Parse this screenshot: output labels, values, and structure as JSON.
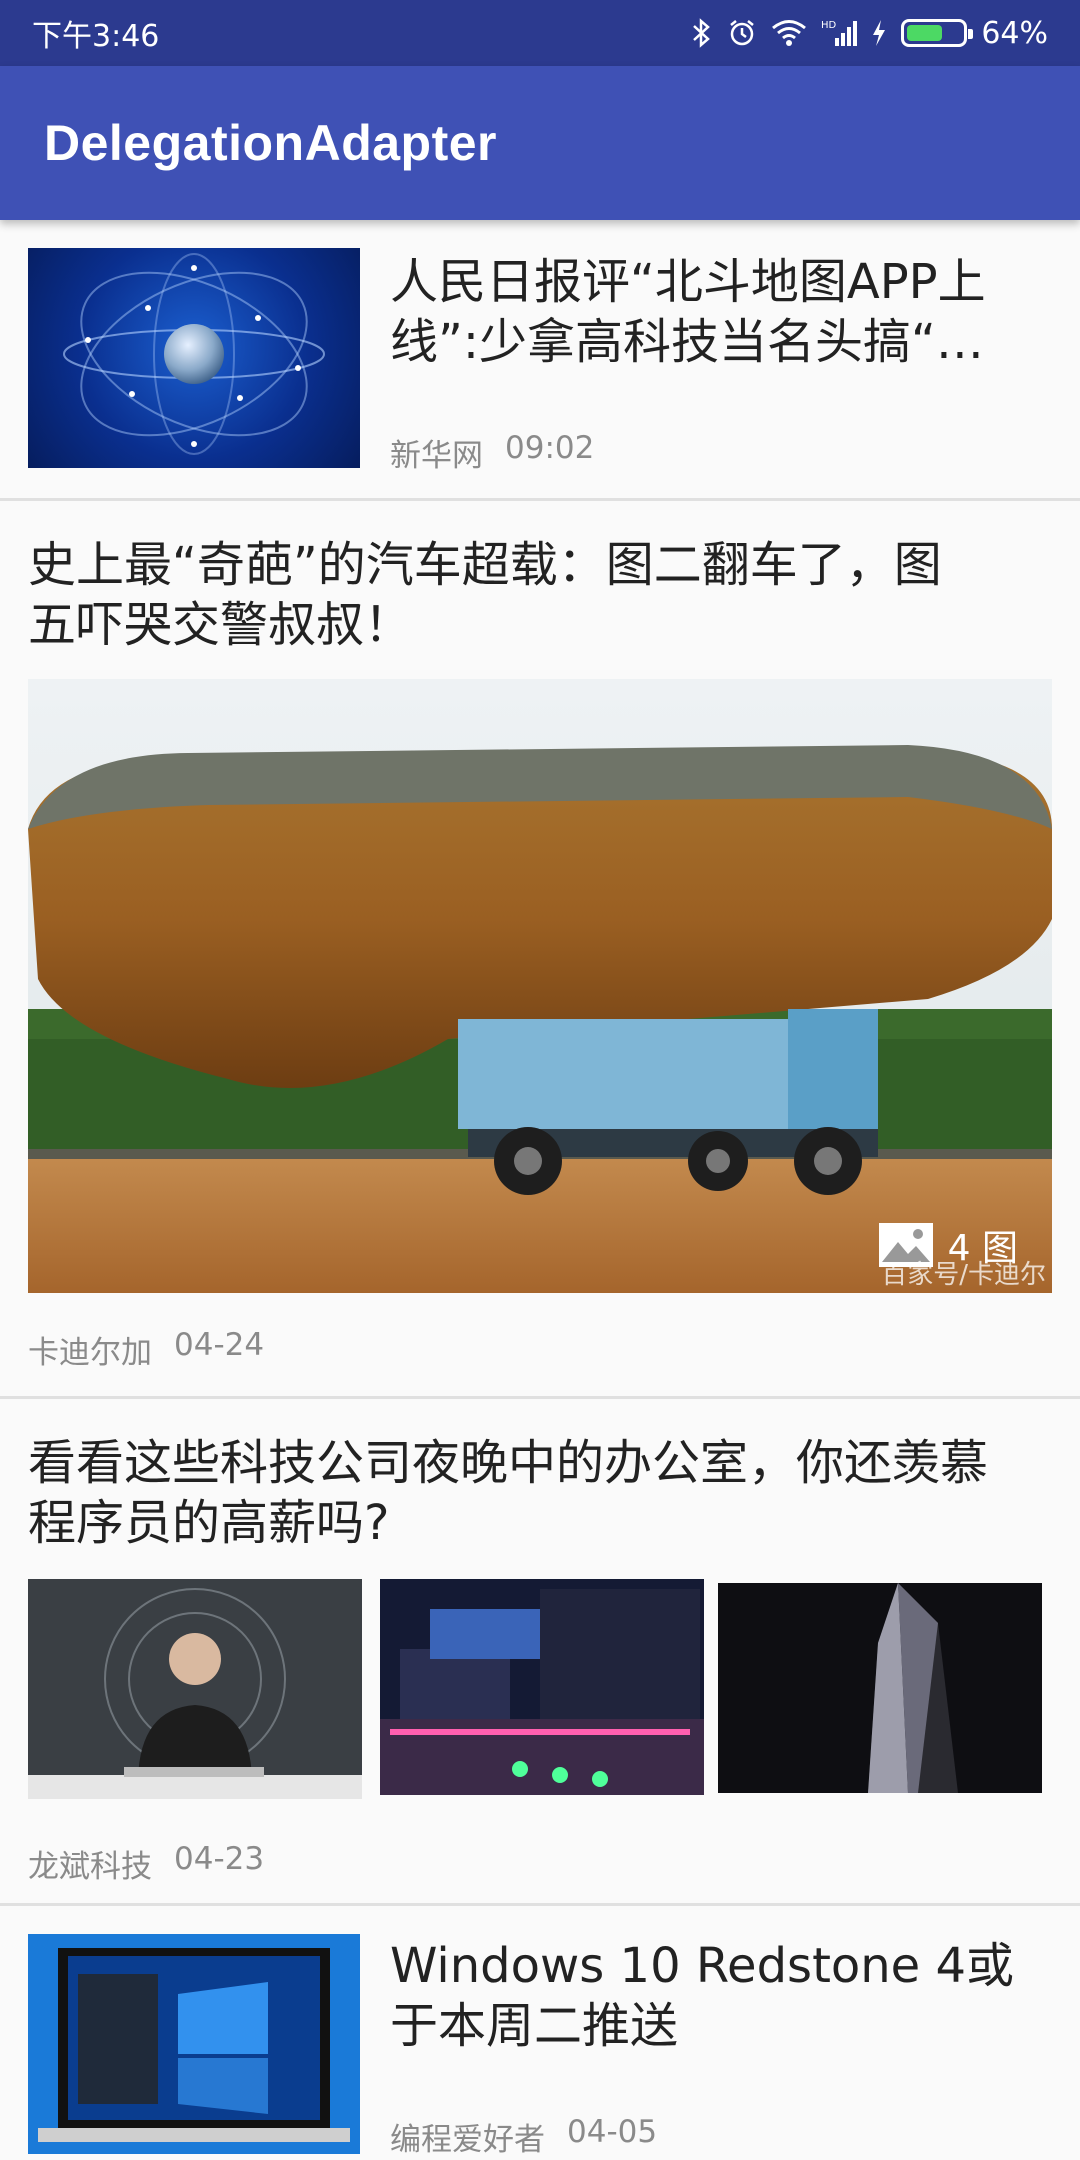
{
  "status_bar": {
    "time": "下午3:46",
    "battery_percent": "64%",
    "battery_level": 0.64,
    "icons": [
      "bluetooth-icon",
      "alarm-icon",
      "wifi-icon",
      "signal-icon",
      "charging-icon",
      "battery-icon"
    ]
  },
  "app_bar": {
    "title": "DelegationAdapter"
  },
  "feed": [
    {
      "type": "small-image-right",
      "title": "人民日报评“北斗地图APP上线”:少拿高科技当名头搞“…",
      "source": "新华网",
      "time": "09:02",
      "image": "satellite-globe"
    },
    {
      "type": "large-image",
      "title": "史上最“奇葩”的汽车超载：图二翻车了，图五吓哭交警叔叔！",
      "source": "卡迪尔加",
      "time": "04-24",
      "image_count_label": "4 图",
      "watermark": "百家号/卡迪尔"
    },
    {
      "type": "three-images",
      "title": "看看这些科技公司夜晚中的办公室，你还羡慕程序员的高薪吗?",
      "source": "龙斌科技",
      "time": "04-23",
      "images": [
        "hacker-portrait",
        "office-night-plaza",
        "tower-night"
      ]
    },
    {
      "type": "small-image-right",
      "title": "Windows 10 Redstone 4或于本周二推送",
      "source": "编程爱好者",
      "time": "04-05",
      "image": "windows-laptop"
    }
  ],
  "colors": {
    "primary": "#3f51b5",
    "primary_dark": "#2c3a8f",
    "meta_text": "#8a8a8a"
  }
}
